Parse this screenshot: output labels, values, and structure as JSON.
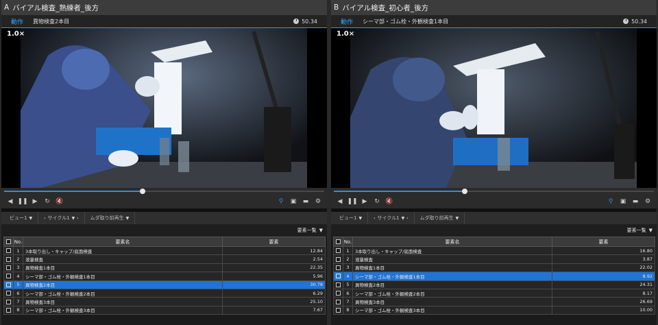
{
  "panes": [
    {
      "letter": "A",
      "title": "バイアル検査_熟練者_後方",
      "motion_label": "動作",
      "step_name": "異物検査2本目",
      "time": "50.34",
      "speed": "1.0×",
      "progress": 0.46,
      "filters": {
        "view": "ビュー1",
        "cycle": "サイクル1",
        "muda": "ムダ取り前再生"
      },
      "list_label": "要素一覧",
      "columns": {
        "no": "No.",
        "name": "要素名",
        "value": "要素"
      },
      "rows": [
        {
          "no": "1",
          "name": "3本取り出し・キャップ/底面検査",
          "value": "12.84",
          "selected": false
        },
        {
          "no": "2",
          "name": "液量検査",
          "value": "2.54",
          "selected": false
        },
        {
          "no": "3",
          "name": "異物検査1本目",
          "value": "22.35",
          "selected": false
        },
        {
          "no": "4",
          "name": "シーマ部・ゴム栓・外観検査1本目",
          "value": "5.96",
          "selected": false
        },
        {
          "no": "5",
          "name": "異物検査2本目",
          "value": "30.78",
          "selected": true
        },
        {
          "no": "6",
          "name": "シーマ部・ゴム栓・外観検査2本目",
          "value": "6.29",
          "selected": false
        },
        {
          "no": "7",
          "name": "異物検査3本目",
          "value": "25.10",
          "selected": false
        },
        {
          "no": "8",
          "name": "シーマ部・ゴム栓・外観検査3本目",
          "value": "7.67",
          "selected": false
        }
      ]
    },
    {
      "letter": "B",
      "title": "バイアル検査_初心者_後方",
      "motion_label": "動作",
      "step_name": "シーマ部・ゴム栓・外観検査1本目",
      "time": "50.34",
      "speed": "1.0×",
      "progress": 0.41,
      "filters": {
        "view": "ビュー1",
        "cycle": "サイクル1",
        "muda": "ムダ取り前再生"
      },
      "list_label": "要素一覧",
      "columns": {
        "no": "No.",
        "name": "要素名",
        "value": "要素"
      },
      "rows": [
        {
          "no": "1",
          "name": "3本取り出し・キャップ/底面検査",
          "value": "16.80",
          "selected": false
        },
        {
          "no": "2",
          "name": "液量検査",
          "value": "3.87",
          "selected": false
        },
        {
          "no": "3",
          "name": "異物検査1本目",
          "value": "22.02",
          "selected": false
        },
        {
          "no": "4",
          "name": "シーマ部・ゴム栓・外観検査1本目",
          "value": "8.92",
          "selected": true
        },
        {
          "no": "5",
          "name": "異物検査2本目",
          "value": "24.31",
          "selected": false
        },
        {
          "no": "6",
          "name": "シーマ部・ゴム栓・外観検査2本目",
          "value": "8.17",
          "selected": false
        },
        {
          "no": "7",
          "name": "異物検査3本目",
          "value": "26.69",
          "selected": false
        },
        {
          "no": "8",
          "name": "シーマ部・ゴム栓・外観検査3本目",
          "value": "10.00",
          "selected": false
        }
      ]
    }
  ],
  "icons": [
    "prev-icon",
    "pause-icon",
    "next-icon",
    "replay-icon",
    "mute-icon",
    "zoom-icon",
    "image-icon",
    "folder-icon",
    "gear-icon"
  ],
  "colors": {
    "accent": "#2f9be6",
    "selected_row": "#1f74d6"
  }
}
